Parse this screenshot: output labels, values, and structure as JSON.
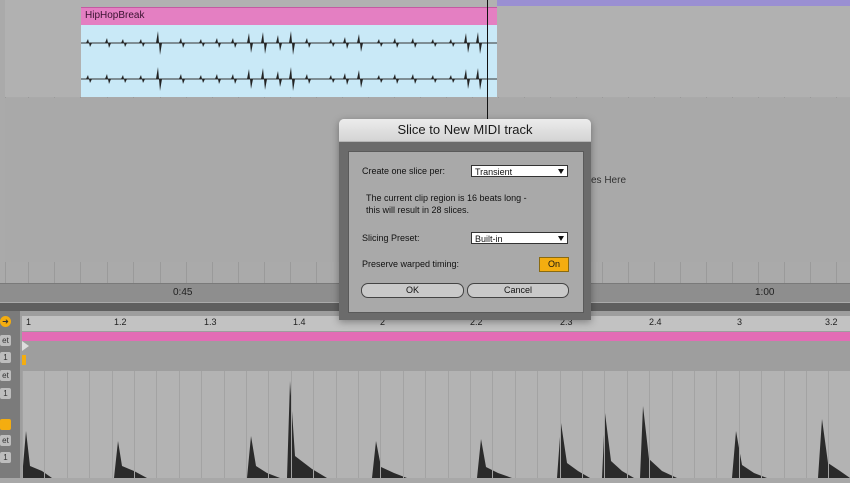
{
  "arrangement": {
    "clip_name": "HipHopBreak",
    "drop_hint": "ces Here",
    "ruler_labels": [
      "0:45",
      "1:00"
    ]
  },
  "detail": {
    "beat_labels": [
      "1",
      "1.2",
      "1.3",
      "1.4",
      "2",
      "2.2",
      "2.3",
      "2.4",
      "3",
      "3.2"
    ],
    "side_buttons": [
      "et",
      "1",
      "et",
      "1",
      "et",
      "1"
    ]
  },
  "dialog": {
    "title": "Slice to New MIDI track",
    "slice_per_label": "Create one slice per:",
    "slice_per_value": "Transient",
    "info_line1": "The current clip region is 16 beats long -",
    "info_line2": "this will result in 28 slices.",
    "preset_label": "Slicing Preset:",
    "preset_value": "Built-in",
    "preserve_label": "Preserve warped timing:",
    "preserve_value": "On",
    "ok_label": "OK",
    "cancel_label": "Cancel"
  },
  "colors": {
    "clip_header": "#e47fc2",
    "clip_body": "#c9e9f7",
    "toggle_on": "#f4ad10",
    "pink_strip": "#e36cb5"
  }
}
